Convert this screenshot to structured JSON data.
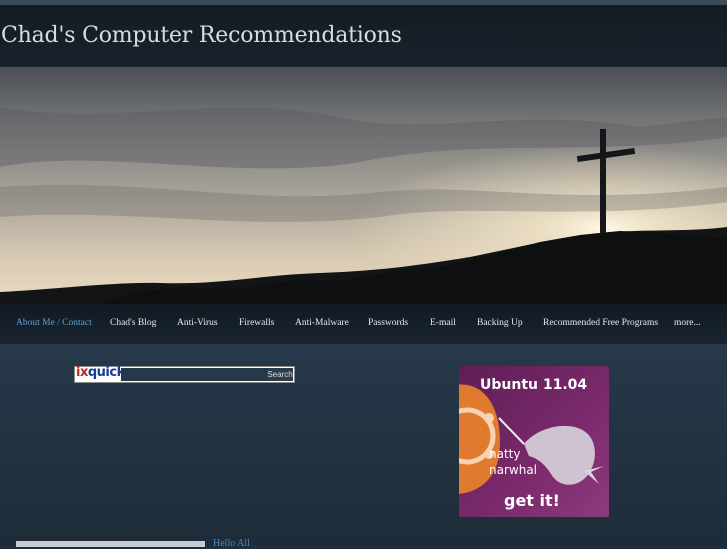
{
  "site": {
    "title": "Chad's Computer Recommendations"
  },
  "nav": {
    "items": [
      {
        "label": "About Me / Contact",
        "active": true
      },
      {
        "label": "Chad's Blog"
      },
      {
        "label": "Anti-Virus"
      },
      {
        "label": "Firewalls"
      },
      {
        "label": "Anti-Malware"
      },
      {
        "label": "Passwords"
      },
      {
        "label": "E-mail"
      },
      {
        "label": "Backing Up"
      },
      {
        "label": "Recommended Free Programs"
      },
      {
        "label": "more..."
      }
    ]
  },
  "search": {
    "logo_ix": "ix",
    "logo_quick": "quick",
    "button_label": "Search",
    "value": ""
  },
  "ad": {
    "title": "Ubuntu 11.04",
    "line1": "natty",
    "line2": "narwhal",
    "cta": "get it!"
  },
  "main": {
    "greeting": "Hello All"
  },
  "colors": {
    "nav_active": "#5fa3d6",
    "ad_purple": "#7b2a6c",
    "ad_orange": "#e07a2e",
    "logo_red": "#d01f1f",
    "logo_blue": "#1a3b9a"
  }
}
